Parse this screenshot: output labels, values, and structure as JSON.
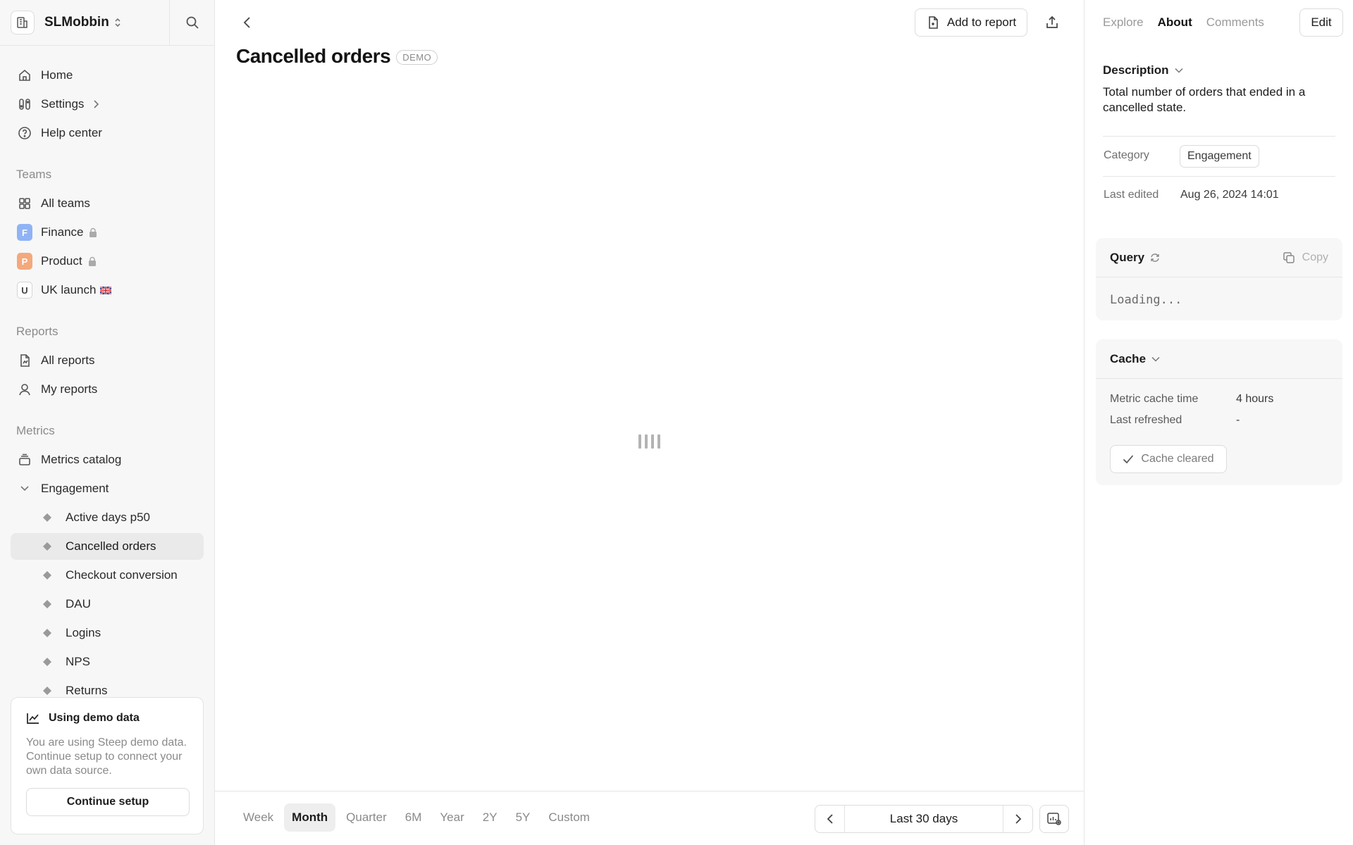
{
  "workspace": {
    "name": "SLMobbin"
  },
  "nav": {
    "home": "Home",
    "settings": "Settings",
    "help": "Help center"
  },
  "teams": {
    "label": "Teams",
    "all": "All teams",
    "items": [
      {
        "badge": "F",
        "name": "Finance",
        "color": "#8fb3f5",
        "locked": true
      },
      {
        "badge": "P",
        "name": "Product",
        "color": "#f3a97c",
        "locked": true
      },
      {
        "badge": "U",
        "name": "UK launch",
        "color": "#ffffff",
        "locked": false
      }
    ]
  },
  "reports": {
    "label": "Reports",
    "all": "All reports",
    "mine": "My reports"
  },
  "metrics": {
    "label": "Metrics",
    "catalog": "Metrics catalog",
    "group": "Engagement",
    "items": [
      "Active days p50",
      "Cancelled orders",
      "Checkout conversion",
      "DAU",
      "Logins",
      "NPS",
      "Returns"
    ],
    "active_index": 1
  },
  "demo_card": {
    "title": "Using demo data",
    "text": "You are using Steep demo data. Continue setup to connect your own data source.",
    "button": "Continue setup"
  },
  "header": {
    "add_to_report": "Add to report",
    "title": "Cancelled orders",
    "badge": "DEMO"
  },
  "range": {
    "tabs": [
      "Week",
      "Month",
      "Quarter",
      "6M",
      "Year",
      "2Y",
      "5Y",
      "Custom"
    ],
    "active_index": 1,
    "period": "Last 30 days"
  },
  "panel": {
    "tabs": [
      "Explore",
      "About",
      "Comments"
    ],
    "active_tab": 1,
    "edit": "Edit",
    "description_label": "Description",
    "description": "Total number of orders that ended in a cancelled state.",
    "category_label": "Category",
    "category": "Engagement",
    "last_edited_label": "Last edited",
    "last_edited": "Aug 26, 2024 14:01",
    "query_label": "Query",
    "copy": "Copy",
    "query_text": "Loading...",
    "cache_label": "Cache",
    "cache_time_label": "Metric cache time",
    "cache_time": "4 hours",
    "last_refreshed_label": "Last refreshed",
    "last_refreshed": "-",
    "cache_button": "Cache cleared"
  }
}
